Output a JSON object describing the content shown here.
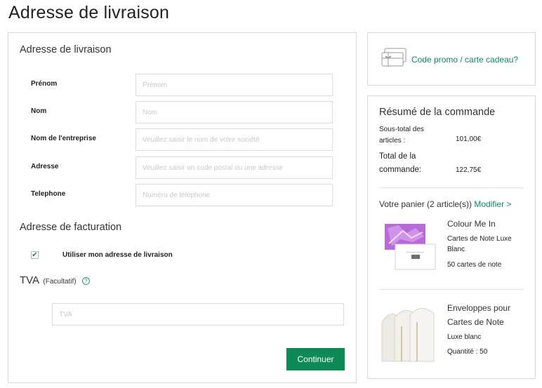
{
  "page": {
    "title": "Adresse de livraison"
  },
  "shipping": {
    "section_title": "Adresse de livraison",
    "fields": [
      {
        "label": "Prénom",
        "placeholder": "Prénom",
        "value": ""
      },
      {
        "label": "Nom",
        "placeholder": "Nom",
        "value": ""
      },
      {
        "label": "Nom de l'entreprise",
        "placeholder": "Veuillez saisir le nom de votre société",
        "value": ""
      },
      {
        "label": "Adresse",
        "placeholder": "Veuillez saisir un code postal ou une adresse",
        "value": ""
      },
      {
        "label": "Telephone",
        "placeholder": "Numéro de téléphone",
        "value": ""
      }
    ]
  },
  "billing": {
    "section_title": "Adresse de facturation",
    "checkbox_checked": true,
    "checkbox_mark": "✔",
    "checkbox_label": "Utiliser mon adresse de livraison"
  },
  "tva": {
    "title": "TVA",
    "optional": "(Facultatif)",
    "help_glyph": "?",
    "placeholder": "TVA"
  },
  "actions": {
    "continue_label": "Continuer"
  },
  "promo": {
    "link_label": "Code promo / carte cadeau?"
  },
  "summary": {
    "title": "Résumé de la commande",
    "subtotal_label": "Sous-total des articles :",
    "subtotal_value": "101,00€",
    "total_label": "Total de la commande:",
    "total_value": "122,75€",
    "cart_text": "Votre panier (2 article(s))",
    "modify_label": "Modifier >"
  },
  "cart_items": [
    {
      "name": "Colour Me In",
      "detail1": "Cartes de Note Luxe Blanc",
      "detail2": "50 cartes de note"
    },
    {
      "name": "Enveloppes pour Cartes de Note",
      "detail1": "Luxe blanc",
      "detail2": "Quantité : 50"
    }
  ],
  "colors": {
    "accent": "#0d8a55",
    "border": "#d9d9d9"
  }
}
